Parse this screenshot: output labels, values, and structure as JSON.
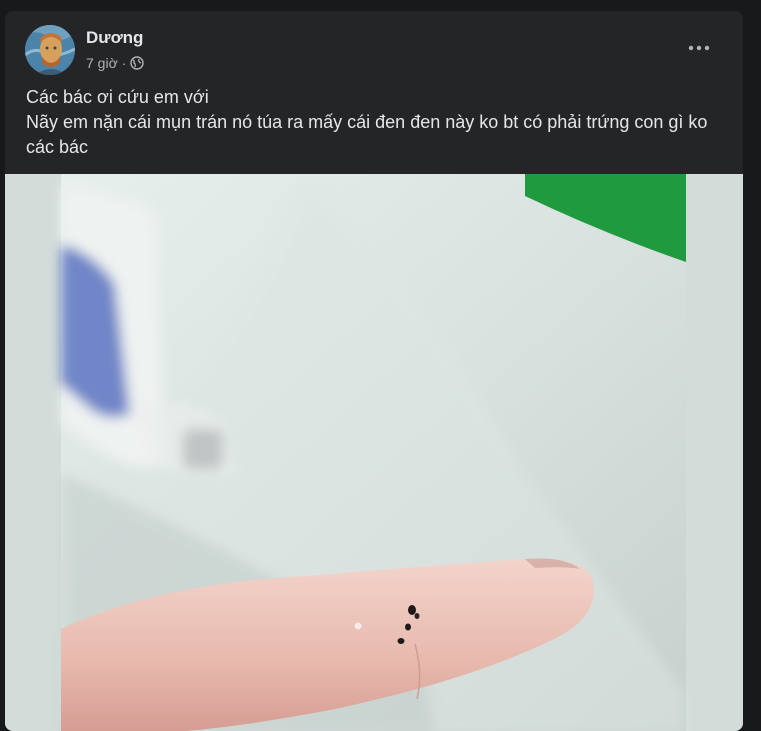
{
  "post": {
    "author": "Dương",
    "time": "7 giờ",
    "separator": "·",
    "audience_icon": "globe-icon",
    "more_icon": "more-options-icon",
    "more_label": "•••",
    "caption_lines": [
      "Các bác ơi cứu em với",
      "Nãy em nặn cái mụn trán nó túa ra mấy cái đen đen này ko bt có phải trứng con gì ko các bác"
    ]
  },
  "colors": {
    "page_bg": "#18191a",
    "card_bg": "#242526",
    "primary_text": "#e4e6eb",
    "secondary_text": "#b0b3b8",
    "photo_border": "#d3dcd9"
  }
}
